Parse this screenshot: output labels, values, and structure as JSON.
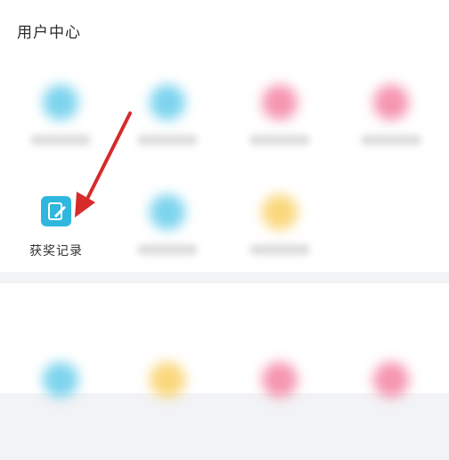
{
  "section": {
    "title": "用户中心"
  },
  "clear_item": {
    "label": "获奖记录",
    "icon": "edit-note-icon"
  },
  "colors": {
    "blue": "#5cc9ea",
    "pink": "#f37c9d",
    "yellow": "#f9cd5b",
    "accent": "#2fb7de",
    "arrow": "#d62b2b"
  }
}
